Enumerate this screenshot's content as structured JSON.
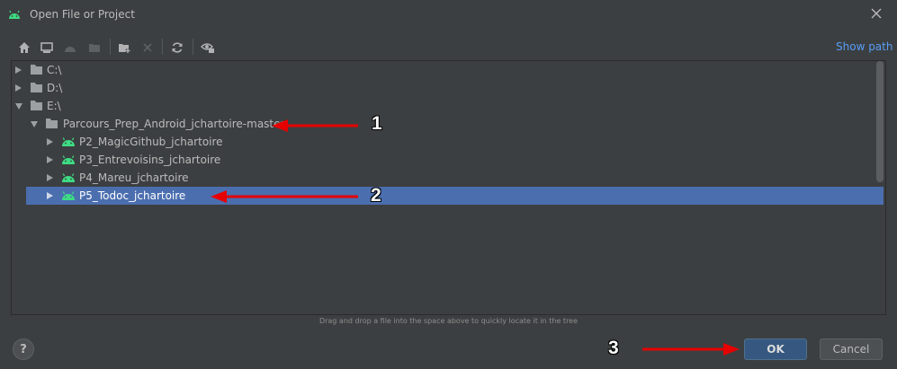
{
  "window": {
    "title": "Open File or Project",
    "app_icon": "android-icon",
    "close_icon": "close-icon"
  },
  "toolbar": {
    "buttons": [
      "home-icon",
      "desktop-icon",
      "android-project-icon",
      "module-folder-icon",
      "new-folder-icon",
      "delete-icon",
      "refresh-icon",
      "show-hidden-icon"
    ],
    "show_path_label": "Show path"
  },
  "tree": {
    "items": [
      {
        "label": "C:\\",
        "icon": "drive-icon",
        "expanded": false
      },
      {
        "label": "D:\\",
        "icon": "drive-icon",
        "expanded": false
      },
      {
        "label": "E:\\",
        "icon": "drive-icon",
        "expanded": true
      },
      {
        "label": "Parcours_Prep_Android_jchartoire-master",
        "icon": "folder-icon",
        "expanded": true
      },
      {
        "label": "P2_MagicGithub_jchartoire",
        "icon": "android-icon",
        "expanded": false
      },
      {
        "label": "P3_Entrevoisins_jchartoire",
        "icon": "android-icon",
        "expanded": false
      },
      {
        "label": "P4_Mareu_jchartoire",
        "icon": "android-icon",
        "expanded": false
      },
      {
        "label": "P5_Todoc_jchartoire",
        "icon": "android-icon",
        "expanded": false,
        "selected": true
      }
    ]
  },
  "hint": "Drag and drop a file into the space above to quickly locate it in the tree",
  "footer": {
    "help_label": "?",
    "ok_label": "OK",
    "cancel_label": "Cancel"
  },
  "annotations": {
    "marker_1": "1",
    "marker_2": "2",
    "marker_3": "3"
  },
  "colors": {
    "accent": "#589df6",
    "selection": "#4b6eaf",
    "android": "#3ddc84",
    "annotation_arrow": "#e60000"
  }
}
